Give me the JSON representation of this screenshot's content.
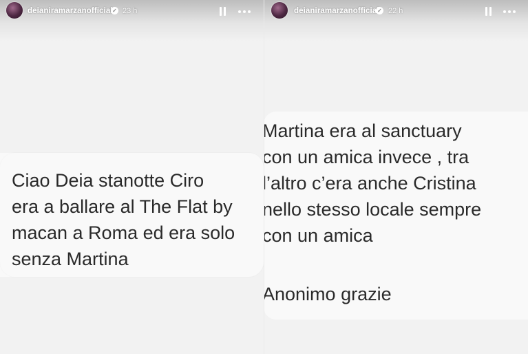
{
  "stories": [
    {
      "username": "deianiramarzanofficial",
      "time": "23 h",
      "message": "Ciao Deia stanotte Ciro\nera a ballare al The Flat by\nmacan a Roma ed era solo\nsenza Martina"
    },
    {
      "username": "deianiramarzanofficial",
      "time": "22 h",
      "message": "Martina era al sanctuary\ncon un amica invece , tra\nl’altro c’era anche Cristina\nnello stesso locale sempre\ncon un amica",
      "signature": "Anonimo grazie"
    }
  ],
  "colors": {
    "background": "#f2f2f2",
    "card": "#f9f9f9",
    "text": "#2a2a2a",
    "header_text": "#ffffff"
  },
  "icons": {
    "verified": "verified-badge-icon",
    "pause": "pause-icon",
    "more": "more-options-icon"
  }
}
